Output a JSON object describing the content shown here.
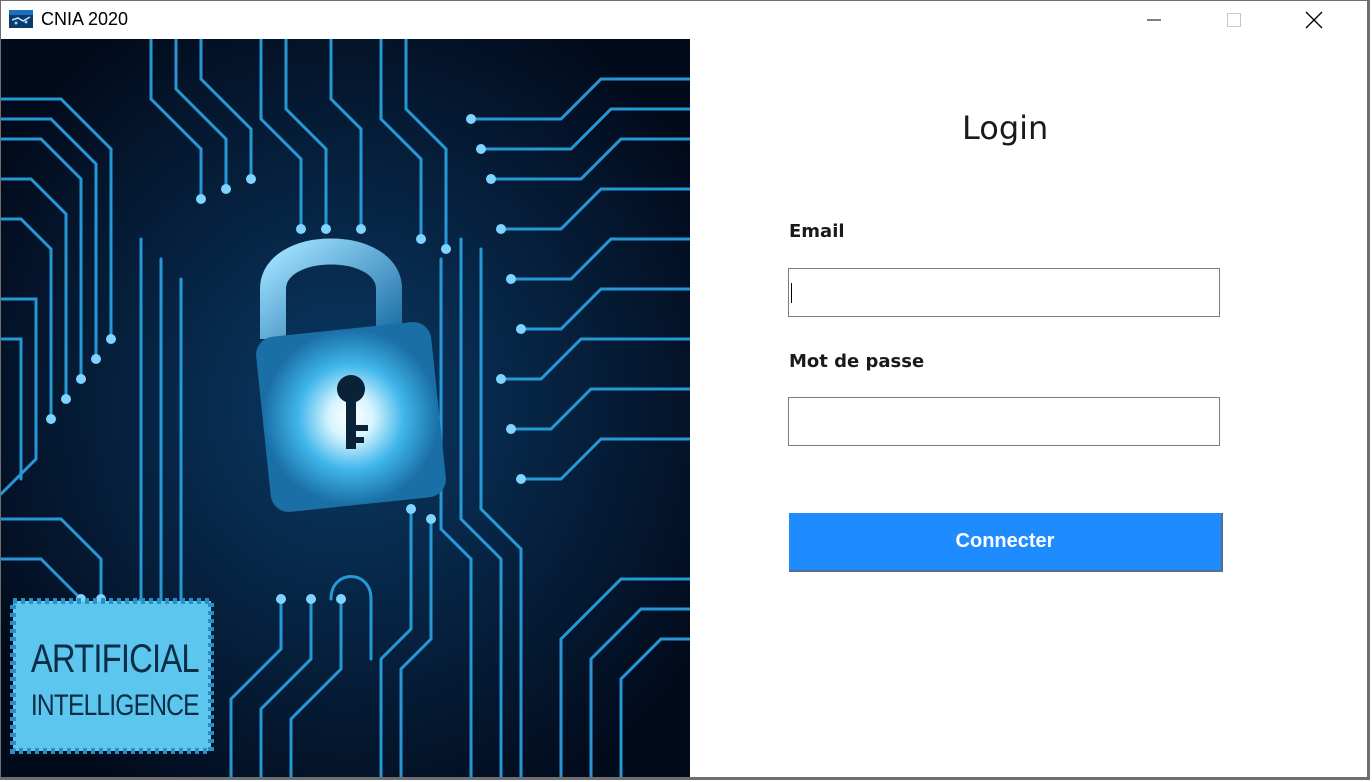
{
  "window": {
    "title": "CNIA 2020",
    "icon": "app-icon",
    "controls": [
      "minimize-icon",
      "maximize-icon",
      "close-icon"
    ]
  },
  "art": {
    "badge_line1": "ARTIFICIAL",
    "badge_line2": "INTELLIGENCE",
    "accent": "#2aa6e8"
  },
  "form": {
    "title": "Login",
    "email_label": "Email",
    "email_value": "",
    "password_label": "Mot de passe",
    "password_value": "",
    "submit_label": "Connecter",
    "button_color": "#1e8cff"
  }
}
